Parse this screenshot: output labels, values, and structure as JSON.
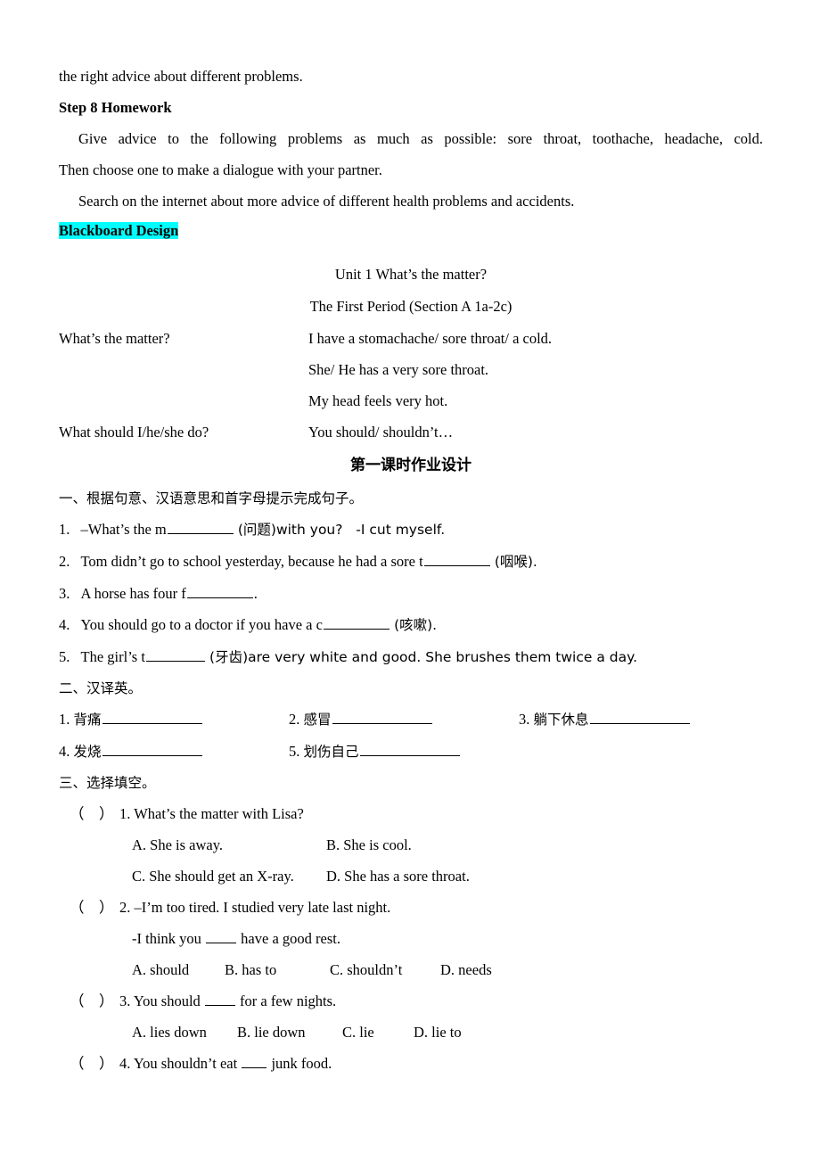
{
  "document": {
    "top_paragraph": "the right advice about different problems.",
    "homework": {
      "heading": "Step 8 Homework",
      "para1": "Give advice to the following problems as much as possible: sore throat, toothache, headache, cold.",
      "para1_cont": "Then choose one to make a dialogue with your partner.",
      "para2": "Search on the internet about more advice of different health problems and accidents."
    },
    "blackboard": {
      "highlight_label": "Blackboard Design",
      "highlight_color": "#00FFFF",
      "title_line1": "Unit 1 What’s the matter?",
      "title_line2": "The First Period (Section A 1a-2c)",
      "rows": [
        {
          "question": "What’s the matter?",
          "answer": "I have a stomachache/ sore throat/ a cold."
        },
        {
          "question": "",
          "answer": "She/ He has a very sore throat."
        },
        {
          "question": "",
          "answer": "My head feels very hot."
        },
        {
          "question": "What should I/he/she do?",
          "answer": "You should/ shouldn’t…"
        }
      ]
    },
    "worksheet": {
      "title": "第一课时作业设计",
      "section1": {
        "heading": "一、根据句意、汉语意思和首字母提示完成句子。",
        "items": [
          {
            "num": "1.",
            "pre": "–What’s the m",
            "post": "(问题)with you?   -I cut myself.",
            "blank": "long"
          },
          {
            "num": "2.",
            "pre": "Tom didn’t go to school yesterday, because he had a sore t",
            "post": "(咽喉).",
            "blank": "long"
          },
          {
            "num": "3.",
            "pre": "A horse has four f",
            "post": ".",
            "blank": "long"
          },
          {
            "num": "4.",
            "pre": "You should go to a doctor if you have a c",
            "post": "(咳嗽).",
            "blank": "long"
          },
          {
            "num": "5.",
            "pre": "The girl’s t",
            "post": "(牙齿)are very white and good. She brushes them twice a day.",
            "blank": "med"
          }
        ]
      },
      "section2": {
        "heading": "二、汉译英。",
        "items": [
          {
            "num": "1.",
            "label": "背痛"
          },
          {
            "num": "2.",
            "label": "感冒"
          },
          {
            "num": "3.",
            "label": "躺下休息"
          },
          {
            "num": "4.",
            "label": "发烧"
          },
          {
            "num": "5.",
            "label": "划伤自己"
          }
        ]
      },
      "section3": {
        "heading": "三、选择填空。",
        "questions": [
          {
            "num": "1.",
            "stem": "What’s the matter with Lisa?",
            "stem2": "",
            "options_rows": [
              [
                "A. She is away.",
                "B. She is cool."
              ],
              [
                "C. She should get an X-ray.",
                "D. She has a sore throat."
              ]
            ]
          },
          {
            "num": "2.",
            "stem": "–I’m too tired. I studied very late last night.",
            "stem2_pre": "-I think you ",
            "stem2_post": " have a good rest.",
            "options_rows": [
              [
                "A. should",
                "B. has to",
                "C. shouldn’t",
                "D. needs"
              ]
            ]
          },
          {
            "num": "3.",
            "stem_pre": "You should ",
            "stem_post": " for a few nights.",
            "options_rows": [
              [
                "A. lies down",
                "B. lie down",
                "C. lie",
                "D. lie to"
              ]
            ]
          },
          {
            "num": "4.",
            "stem_pre": "You shouldn’t eat ",
            "stem_post": " junk food.",
            "options_rows": []
          }
        ]
      }
    }
  }
}
